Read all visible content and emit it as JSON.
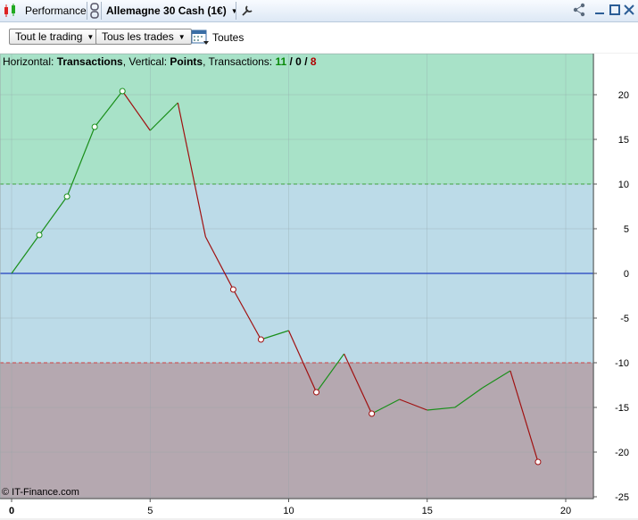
{
  "titlebar": {
    "tab_label": "Performance",
    "instrument": "Allemagne 30 Cash (1€)",
    "icons": [
      "candles-icon",
      "link-icon",
      "wrench-icon",
      "share-icon",
      "minimize-icon",
      "maximize-icon",
      "close-icon"
    ]
  },
  "toolbar": {
    "filter_trading": "Tout le trading",
    "filter_trades": "Tous les trades",
    "period_label": "Toutes"
  },
  "header": {
    "horizontal_label": "Horizontal: ",
    "horizontal_value": "Transactions",
    "vertical_label": ", Vertical: ",
    "vertical_value": "Points",
    "transactions_label": ", Transactions: ",
    "wins": "11",
    "slash1": " / ",
    "neutral": "0",
    "slash2": " / ",
    "losses": "8"
  },
  "credit": "© IT-Finance.com",
  "colors": {
    "up": "#1a8f1a",
    "down": "#a01010",
    "zero_line": "#1f3fbf",
    "zone_top": "#a8e2c8",
    "zone_mid": "#bcdbe8",
    "zone_bottom": "#b5a8b0"
  },
  "chart_data": {
    "type": "line",
    "x_ticks": [
      0,
      5,
      10,
      15,
      20
    ],
    "y_ticks": [
      20,
      15,
      10,
      5,
      0,
      -5,
      -10,
      -15,
      -20,
      -25
    ],
    "xlim": [
      0,
      20.8
    ],
    "ylim": [
      -25,
      24
    ],
    "upper_threshold": 10,
    "lower_threshold": -10,
    "x": [
      0,
      1,
      2,
      3,
      4,
      5,
      6,
      7,
      8,
      9,
      10,
      11,
      12,
      13,
      14,
      15,
      16,
      17,
      18,
      19
    ],
    "y": [
      0,
      4.3,
      8.6,
      16.4,
      20.4,
      16,
      19.1,
      4.1,
      -1.8,
      -7.4,
      -6.4,
      -13.3,
      -9,
      -15.7,
      -14.1,
      -15.3,
      -15,
      -12.8,
      -10.9,
      -21.1
    ],
    "markers": [
      1,
      2,
      3,
      4,
      8,
      9,
      11,
      13,
      19
    ]
  }
}
